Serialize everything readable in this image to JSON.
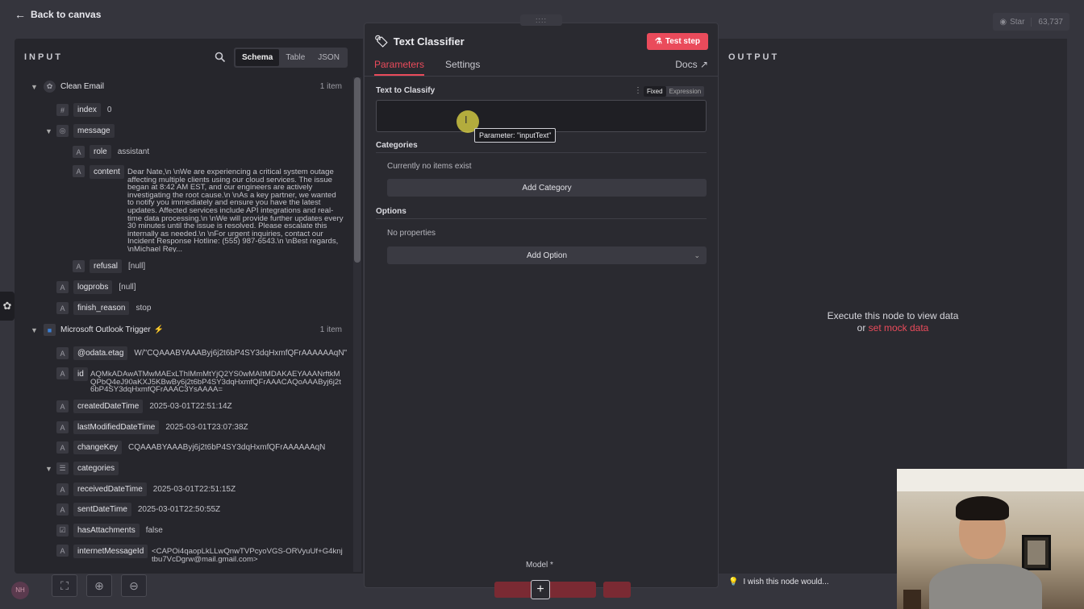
{
  "topbar": {
    "back_label": "Back to canvas",
    "star_label": "Star",
    "star_count": "63,737"
  },
  "input": {
    "title": "INPUT",
    "view_tabs": [
      "Schema",
      "Table",
      "JSON"
    ],
    "active_view": "Schema",
    "clean_email": {
      "name": "Clean Email",
      "count": "1 item",
      "index_key": "index",
      "index_val": "0",
      "message_key": "message",
      "role_key": "role",
      "role_val": "assistant",
      "content_key": "content",
      "content_val": "Dear Nate,\\n \\nWe are experiencing a critical system outage affecting multiple clients using our cloud services. The issue began at 8:42 AM EST, and our engineers are actively investigating the root cause.\\n \\nAs a key partner, we wanted to notify you immediately and ensure you have the latest updates. Affected services include API integrations and real-time data processing.\\n \\nWe will provide further updates every 30 minutes until the issue is resolved. Please escalate this internally as needed.\\n \\nFor urgent inquiries, contact our Incident Response Hotline: (555) 987-6543.\\n \\nBest regards, \\nMichael Rey...",
      "refusal_key": "refusal",
      "refusal_val": "[null]",
      "logprobs_key": "logprobs",
      "logprobs_val": "[null]",
      "finish_key": "finish_reason",
      "finish_val": "stop"
    },
    "outlook": {
      "name": "Microsoft Outlook Trigger",
      "count": "1 item",
      "etag_key": "@odata.etag",
      "etag_val": "W/\"CQAAABYAAAByj6j2t6bP4SY3dqHxmfQFrAAAAAAqN\"",
      "id_key": "id",
      "id_val": "AQMkADAwATMwMAExLThlMmMtYjQ2YS0wMAItMDAKAEYAAANrftkMQPbQ4eJ90aKXJ5KBwBy6j2t6bP4SY3dqHxmfQFrAAACAQoAAAByj6j2t6bP4SY3dqHxmfQFrAAAC3YsAAAA=",
      "created_key": "createdDateTime",
      "created_val": "2025-03-01T22:51:14Z",
      "modified_key": "lastModifiedDateTime",
      "modified_val": "2025-03-01T23:07:38Z",
      "change_key": "changeKey",
      "change_val": "CQAAABYAAAByj6j2t6bP4SY3dqHxmfQFrAAAAAAqN",
      "categories_key": "categories",
      "received_key": "receivedDateTime",
      "received_val": "2025-03-01T22:51:15Z",
      "sent_key": "sentDateTime",
      "sent_val": "2025-03-01T22:50:55Z",
      "attach_key": "hasAttachments",
      "attach_val": "false",
      "msgid_key": "internetMessageId",
      "msgid_val": "<CAPOi4qaopLkLLwQnwTVPcyoVGS-ORVyuUf+G4knjtbu7VcDgrw@mail.gmail.com>"
    }
  },
  "node": {
    "title": "Text Classifier",
    "test_label": "Test step",
    "tabs": [
      "Parameters",
      "Settings"
    ],
    "docs_label": "Docs",
    "text_label": "Text to Classify",
    "toggle_fixed": "Fixed",
    "toggle_expression": "Expression",
    "tooltip": "Parameter: \"inputText\"",
    "categories_label": "Categories",
    "categories_empty": "Currently no items exist",
    "add_category": "Add Category",
    "options_label": "Options",
    "options_empty": "No properties",
    "add_option": "Add Option",
    "model_label": "Model *",
    "drag_handle": "::::"
  },
  "output": {
    "title": "OUTPUT",
    "exec_line1": "Execute this node to view data",
    "exec_or": "or",
    "mock_link": "set mock data"
  },
  "feedback": {
    "wish_label": "I wish this node would..."
  },
  "colors": {
    "accent": "#ea4b5b",
    "panel": "#26262c",
    "background": "#35353d"
  }
}
